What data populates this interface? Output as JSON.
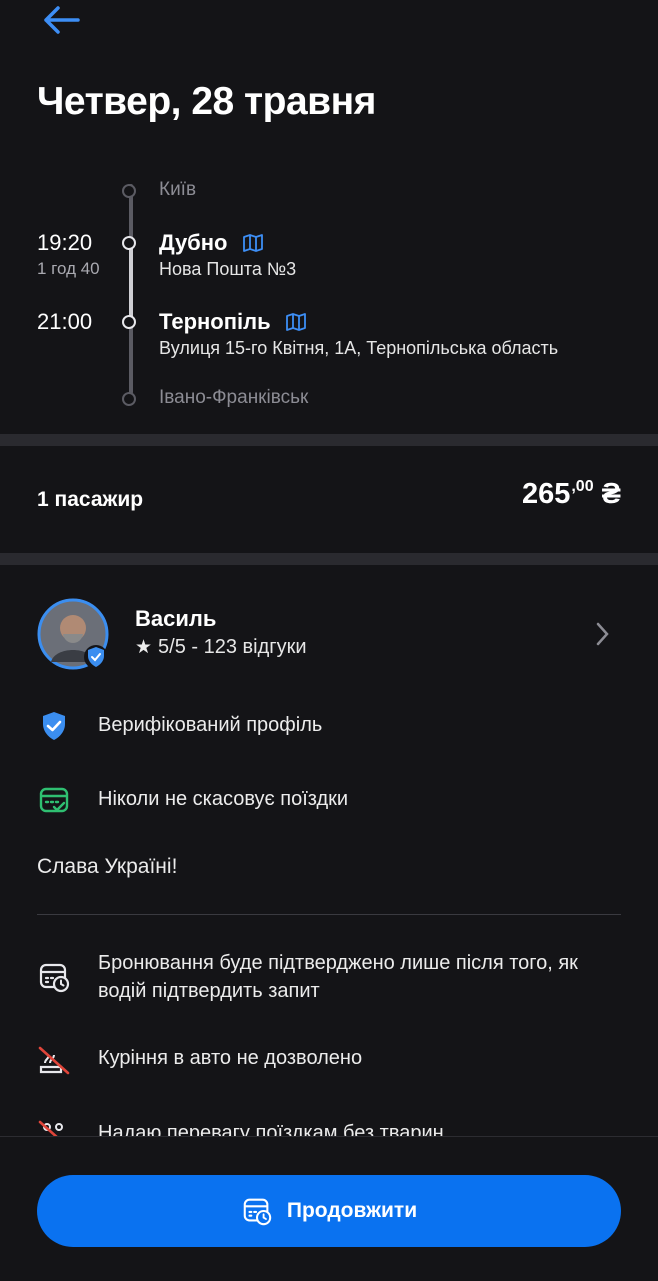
{
  "header": {
    "title": "Четвер, 28 травня",
    "back_icon": "arrow-left-icon"
  },
  "route": {
    "origin": "Київ",
    "departure": {
      "time": "19:20",
      "duration": "1 год 40",
      "city": "Дубно",
      "address": "Нова Пошта №3"
    },
    "arrival": {
      "time": "21:00",
      "city": "Тернопіль",
      "address": "Вулиця 15-го Квітня, 1А, Тернопільська область"
    },
    "destination": "Івано-Франківськ"
  },
  "booking": {
    "passengers": "1 пасажир",
    "price_main": "265",
    "price_cents": ",00",
    "currency": "₴"
  },
  "driver": {
    "name": "Василь",
    "rating": "5/5 - 123 відгуки"
  },
  "features": [
    {
      "icon": "shield-check-icon",
      "text": "Верифікований профіль"
    },
    {
      "icon": "calendar-check-icon",
      "text": "Ніколи не скасовує поїздки"
    }
  ],
  "slogan": "Слава Україні!",
  "rules": [
    {
      "icon": "calendar-clock-icon",
      "text": "Бронювання буде підтверджено лише після того, як водій підтвердить запит"
    },
    {
      "icon": "no-smoking-icon",
      "text": "Куріння в авто не дозволено"
    },
    {
      "icon": "no-pets-icon",
      "text": "Надаю перевагу поїздкам без тварин"
    }
  ],
  "cta": {
    "label": "Продовжити",
    "icon": "calendar-clock-icon"
  },
  "colors": {
    "background": "#141417",
    "accent": "#0a72f0",
    "verified": "#3b8ef0",
    "success": "#2fbf71",
    "danger": "#e0453a"
  }
}
